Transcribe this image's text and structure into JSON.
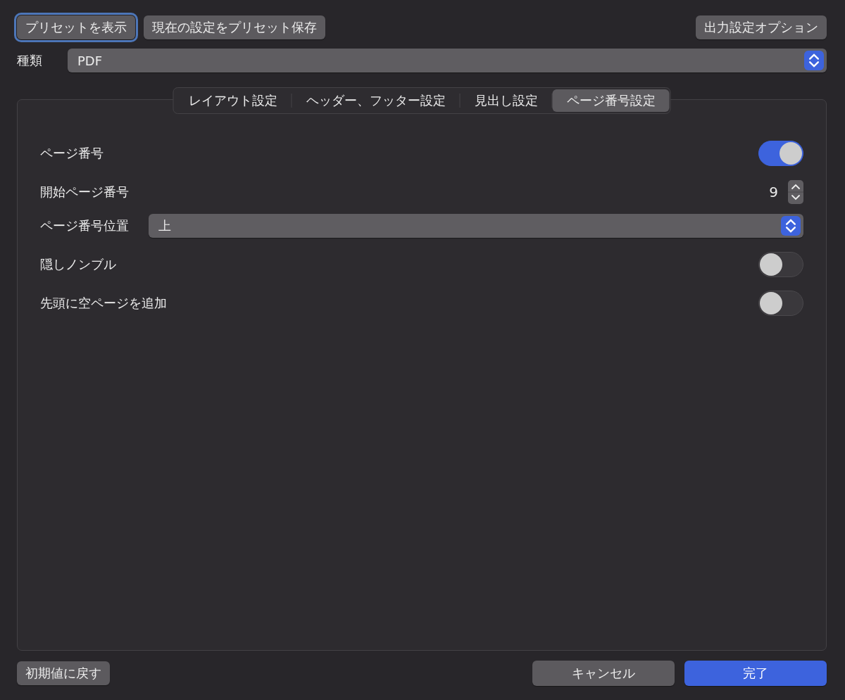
{
  "top_buttons": [
    {
      "label": "プリセットを表示",
      "focused": true
    },
    {
      "label": "現在の設定をプリセット保存",
      "focused": false
    }
  ],
  "options_button": {
    "label": "出力設定オプション"
  },
  "type_row": {
    "label": "種類",
    "value": "PDF"
  },
  "tabs": [
    {
      "label": "レイアウト設定",
      "selected": false
    },
    {
      "label": "ヘッダー、フッター設定",
      "selected": false
    },
    {
      "label": "見出し設定",
      "selected": false
    },
    {
      "label": "ページ番号設定",
      "selected": true
    }
  ],
  "settings": [
    {
      "kind": "toggle",
      "label": "ページ番号",
      "on": true
    },
    {
      "kind": "stepper",
      "label": "開始ページ番号",
      "value": "9"
    },
    {
      "kind": "select",
      "label": "ページ番号位置",
      "value": "上"
    },
    {
      "kind": "toggle",
      "label": "隠しノンブル",
      "on": false
    },
    {
      "kind": "toggle",
      "label": "先頭に空ページを追加",
      "on": false
    }
  ],
  "reset_button": {
    "label": "初期値に戻す"
  },
  "bottom_buttons": [
    {
      "label": "キャンセル",
      "kind": "default"
    },
    {
      "label": "完了",
      "kind": "primary"
    }
  ]
}
